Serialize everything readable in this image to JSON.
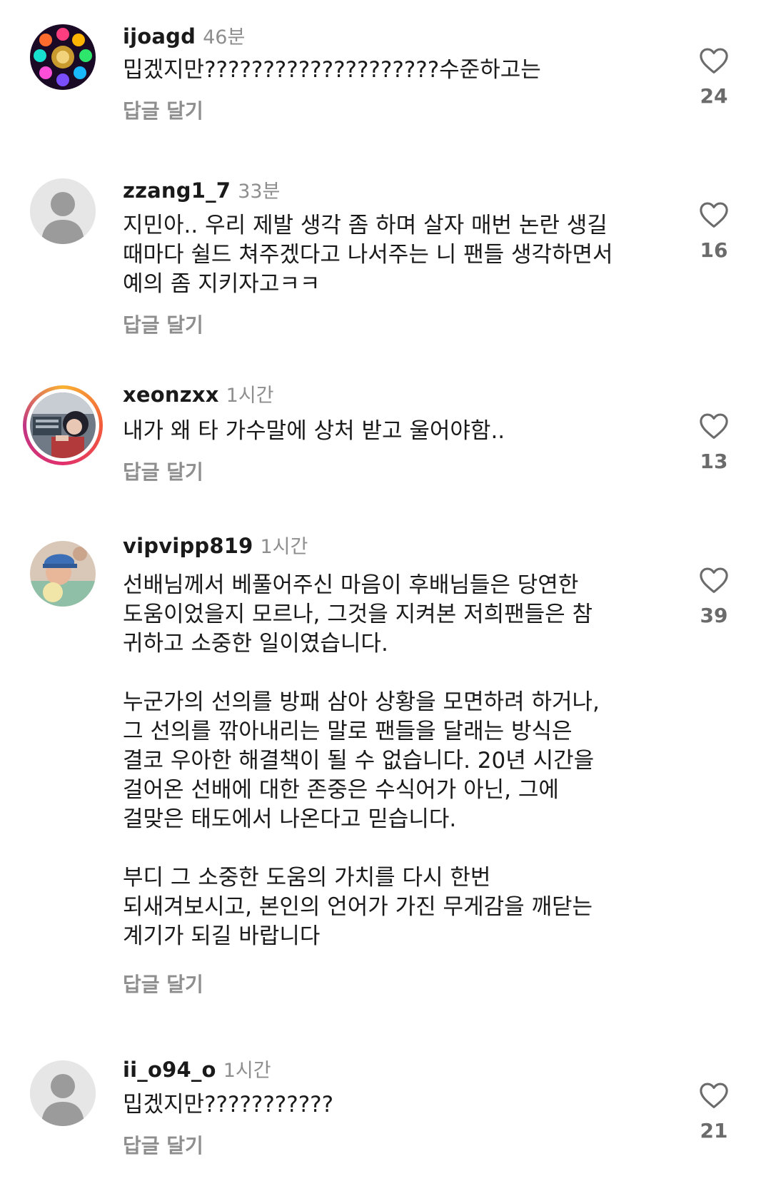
{
  "comments": [
    {
      "username": "ijoagd",
      "time": "46분",
      "text": "밉겠지만????????????????????수준하고는",
      "reply_label": "답글 달기",
      "likes": "24",
      "avatar": "colorful-flower-avatar"
    },
    {
      "username": "zzang1_7",
      "time": "33분",
      "text": "지민아.. 우리 제발 생각 좀 하며 살자 매번 논란 생길\n때마다 쉴드 쳐주겠다고 나서주는 니 팬들 생각하면서\n예의 좀 지키자고ㅋㅋ",
      "reply_label": "답글 달기",
      "likes": "16",
      "avatar": "default-avatar"
    },
    {
      "username": "xeonzxx",
      "time": "1시간",
      "text": "내가 왜 타 가수말에 상처 받고 울어야함..",
      "reply_label": "답글 달기",
      "likes": "13",
      "avatar": "photo-avatar-with-story-ring"
    },
    {
      "username": "vipvipp819",
      "time": "1시간",
      "text": "선배님께서 베풀어주신 마음이 후배님들은  당연한\n도움이었을지 모르나, 그것을 지켜본 저희팬들은 참\n귀하고 소중한 일이였습니다.\n\n누군가의 선의를 방패 삼아 상황을 모면하려 하거나,\n그 선의를 깎아내리는 말로 팬들을 달래는 방식은\n결코 우아한 해결책이 될 수 없습니다. 20년 시간을\n걸어온 선배에 대한 존중은 수식어가 아닌, 그에\n걸맞은 태도에서 나온다고 믿습니다.\n\n부디 그 소중한 도움의 가치를 다시 한번\n되새겨보시고, 본인의 언어가 가진 무게감을 깨닫는\n계기가 되길 바랍니다",
      "reply_label": "답글 달기",
      "likes": "39",
      "avatar": "photo-avatar"
    },
    {
      "username": "ii_o94_o",
      "time": "1시간",
      "text": "밉겠지만???????????",
      "reply_label": "답글 달기",
      "likes": "21",
      "avatar": "default-avatar"
    }
  ],
  "colors": {
    "secondary_text": "#8e8e8e",
    "primary_text": "#1a1a1a",
    "default_avatar_bg": "#e6e6e6",
    "default_avatar_fg": "#9b9b9b"
  }
}
